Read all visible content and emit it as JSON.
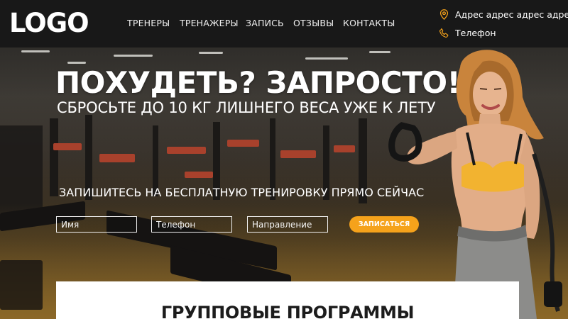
{
  "header": {
    "logo": "LOGO",
    "nav": [
      {
        "label": "ТРЕНЕРЫ"
      },
      {
        "label": "ТРЕНАЖЕРЫ"
      },
      {
        "label": "ЗАПИСЬ"
      },
      {
        "label": "ОТЗЫВЫ"
      },
      {
        "label": "КОНТАКТЫ"
      }
    ],
    "address": {
      "text": "Адрес адрес адрес адрес",
      "icon": "location-pin-icon"
    },
    "phone": {
      "text": "Телефон",
      "icon": "phone-icon"
    }
  },
  "hero": {
    "headline": "ПОХУДЕТЬ? ЗАПРОСТО!",
    "subheadline": "СБРОСЬТЕ ДО 10 КГ ЛИШНЕГО ВЕСА УЖЕ К ЛЕТУ",
    "cta_text": "ЗАПИШИТЕСЬ НА БЕСПЛАТНУЮ ТРЕНИРОВКУ ПРЯМО СЕЙЧАС",
    "form": {
      "name_placeholder": "Имя",
      "phone_placeholder": "Телефон",
      "direction_placeholder": "Направление",
      "submit_label": "ЗАПИСАТЬСЯ"
    }
  },
  "programs": {
    "title": "ГРУППОВЫЕ ПРОГРАММЫ"
  },
  "colors": {
    "header_bg": "#181818",
    "accent": "#f5a21b",
    "text_light": "#ffffff",
    "card_bg": "#ffffff"
  }
}
